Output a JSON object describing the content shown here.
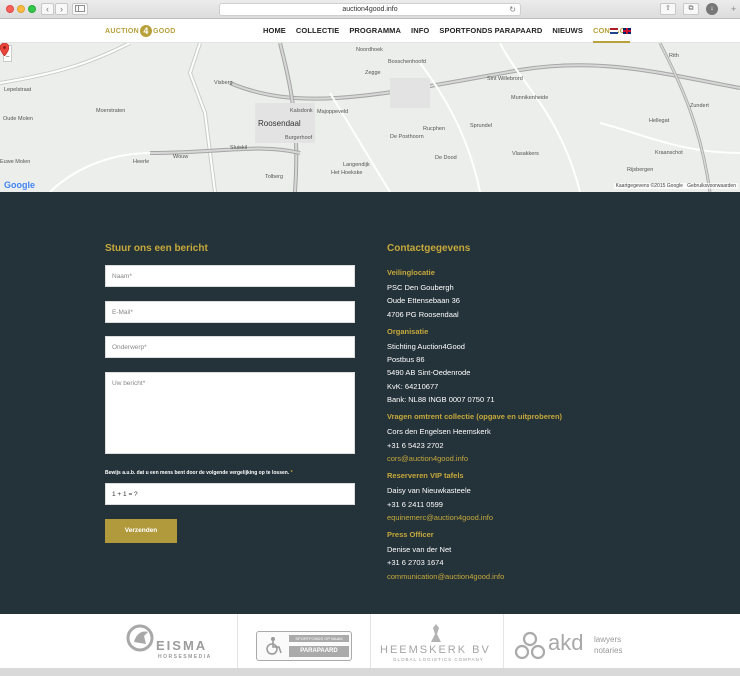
{
  "browser": {
    "url": "auction4good.info",
    "back_glyph": "‹",
    "forward_glyph": "›",
    "reload_glyph": "↻",
    "share_glyph": "⇧",
    "tabs_glyph": "⧉",
    "download_glyph": "↓",
    "new_tab_glyph": "+"
  },
  "site": {
    "logo_left": "AUCTION",
    "logo_number": "4",
    "logo_right": "GOOD",
    "nav": [
      "HOME",
      "COLLECTIE",
      "PROGRAMMA",
      "INFO",
      "SPORTFONDS PARAPAARD",
      "NIEUWS",
      "CONTACT"
    ],
    "active_nav": "CONTACT"
  },
  "map": {
    "zoom_in": "+",
    "zoom_out": "−",
    "places": [
      "Noordhoek",
      "Bosschenhoofd",
      "Zegge",
      "Sint Willebrord",
      "Munnikenheide",
      "Lepelstraat",
      "Visberg",
      "Kalsdonk",
      "Moerstraten",
      "Roosendaal",
      "Majoppeveld",
      "Oude Molen",
      "Burgerhoof",
      "De Posthoorn",
      "Rucphen",
      "Sprundel",
      "Heerle",
      "Wouw",
      "Langendijk",
      "De Dood",
      "Vlasakkers",
      "Sluiskil",
      "Kraanschot",
      "Tolberg",
      "Het Hoekske",
      "Rijsbergen",
      "Rith",
      "Hellegat",
      "Zundert",
      "Euwe Molen"
    ],
    "attribution": "Kaartgegevens ©2015 Google",
    "terms": "Gebruiksvoorwaarden",
    "google": "Google"
  },
  "form": {
    "title": "Stuur ons een bericht",
    "name_placeholder": "Naam*",
    "email_placeholder": "E-Mail*",
    "subject_placeholder": "Onderwerp*",
    "message_placeholder": "Uw bericht*",
    "captcha_label": "Bewijs a.u.b. dat u een mens bent door de volgende vergelijking op te lossen.",
    "captcha_required": "*",
    "captcha_question": "1 + 1 = ?",
    "submit_label": "Verzenden"
  },
  "contact": {
    "title": "Contactgegevens",
    "sections": [
      {
        "heading": "Veilinglocatie",
        "lines": [
          "PSC Den Goubergh",
          "Oude Ettensebaan 36",
          "4706 PG Roosendaal"
        ],
        "link": ""
      },
      {
        "heading": "Organisatie",
        "lines": [
          "Stichting Auction4Good",
          "Postbus 86",
          "5490 AB Sint-Oedenrode",
          "KvK: 64210677",
          "Bank: NL88 INGB 0007 0750 71"
        ],
        "link": ""
      },
      {
        "heading": "Vragen omtrent collectie (opgave en uitproberen)",
        "lines": [
          "Cors den Engelsen Heemskerk",
          "+31 6 5423 2702"
        ],
        "link": "cors@auction4good.info"
      },
      {
        "heading": "Reserveren VIP tafels",
        "lines": [
          "Daisy van Nieuwkasteele",
          "+31 6 2411 0599"
        ],
        "link": "equinemerc@auction4good.info"
      },
      {
        "heading": "Press Officer",
        "lines": [
          "Denise van der Net",
          "+31 6 2703 1674"
        ],
        "link": "communication@auction4good.info"
      }
    ]
  },
  "sponsors": {
    "eisma_name": "EISMA",
    "eisma_sub": "HORSESMEDIA",
    "parapaard_top": "SPORTFONDS OP NAAM",
    "parapaard_name": "PARAPAARD",
    "heemskerk_name": "HEEMSKERK BV",
    "heemskerk_sub": "GLOBAL LOGISTICS COMPANY",
    "akd_name": "akd",
    "akd_line1": "lawyers",
    "akd_line2": "notaries"
  },
  "colors": {
    "accent": "#c6a93a",
    "dark_bg": "#24323a",
    "button": "#b19a3c"
  }
}
